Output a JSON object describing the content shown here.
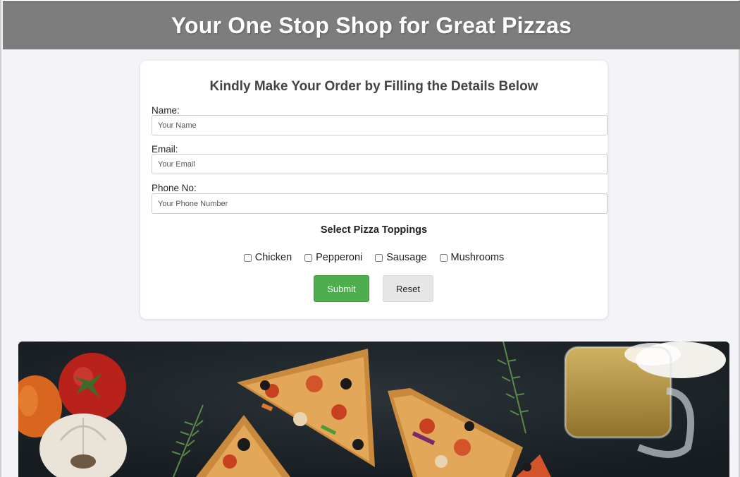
{
  "header": {
    "title": "Your One Stop Shop for Great Pizzas"
  },
  "form": {
    "heading": "Kindly Make Your Order by Filling the Details Below",
    "name_label": "Name:",
    "name_placeholder": "Your Name",
    "name_value": "",
    "email_label": "Email:",
    "email_placeholder": "Your Email",
    "email_value": "",
    "phone_label": "Phone No:",
    "phone_placeholder": "Your Phone Number",
    "phone_value": "",
    "toppings_title": "Select Pizza Toppings",
    "toppings": [
      {
        "label": "Chicken",
        "checked": false
      },
      {
        "label": "Pepperoni",
        "checked": false
      },
      {
        "label": "Sausage",
        "checked": false
      },
      {
        "label": "Mushrooms",
        "checked": false
      }
    ],
    "submit_label": "Submit",
    "reset_label": "Reset"
  },
  "colors": {
    "header_bg": "#7d7d7d",
    "submit_bg": "#4cae4c",
    "reset_bg": "#e6e6e6",
    "page_bg": "#f4f4f8"
  },
  "hero": {
    "image": "pizza-hero-photo"
  }
}
